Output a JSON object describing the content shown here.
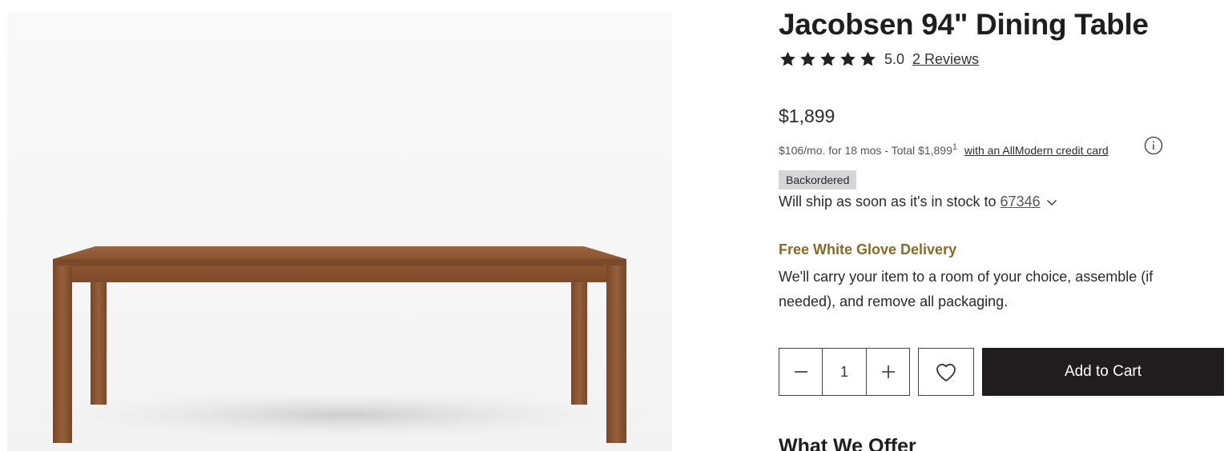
{
  "product": {
    "title": "Jacobsen 94\" Dining Table",
    "rating": "5.0",
    "stars_filled": 5,
    "stars_total": 5,
    "reviews_link": "2 Reviews",
    "price": "$1,899",
    "financing": {
      "text": "$106/mo. for 18 mos - Total $1,899",
      "footnote": "1",
      "link": "with an AllModern credit card"
    },
    "availability_badge": "Backordered",
    "shipping": {
      "text": "Will ship as soon as it's in stock to",
      "zip": "67346"
    },
    "delivery": {
      "title": "Free White Glove Delivery",
      "text": "We'll carry your item to a room of your choice, assemble (if needed), and remove all packaging."
    },
    "quantity": "1",
    "add_to_cart": "Add to Cart",
    "next_section_heading": "What We Offer"
  },
  "icons": {
    "star": "star-icon",
    "info": "info-icon",
    "chevron": "chevron-down-icon",
    "minus": "minus-icon",
    "plus": "plus-icon",
    "favorite": "heart-icon"
  },
  "colors": {
    "accent_gold": "#8a6a28",
    "cart_button": "#1f1d1e",
    "badge_bg": "#d6d6d8",
    "wood": "#8a5530"
  }
}
